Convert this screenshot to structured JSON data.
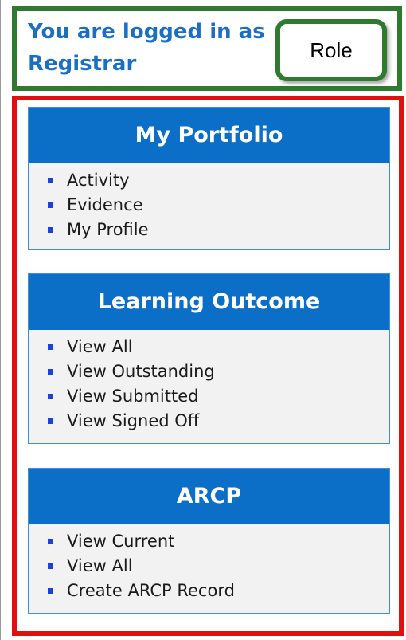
{
  "header": {
    "logged_in_text": "You are logged in as Registrar",
    "role_callout": "Role"
  },
  "panels": [
    {
      "title": "My Portfolio",
      "items": [
        "Activity",
        "Evidence",
        "My Profile"
      ]
    },
    {
      "title": "Learning Outcome",
      "items": [
        "View All",
        "View Outstanding",
        "View Submitted",
        "View Signed Off"
      ]
    },
    {
      "title": "ARCP",
      "items": [
        "View Current",
        "View All",
        "Create ARCP Record"
      ]
    }
  ],
  "colors": {
    "panel_header": "#0b6fc7",
    "header_text": "#1a6fc4",
    "bullet": "#1d3ee0",
    "callout_green": "#2e7a2e",
    "callout_red": "#e01010"
  }
}
